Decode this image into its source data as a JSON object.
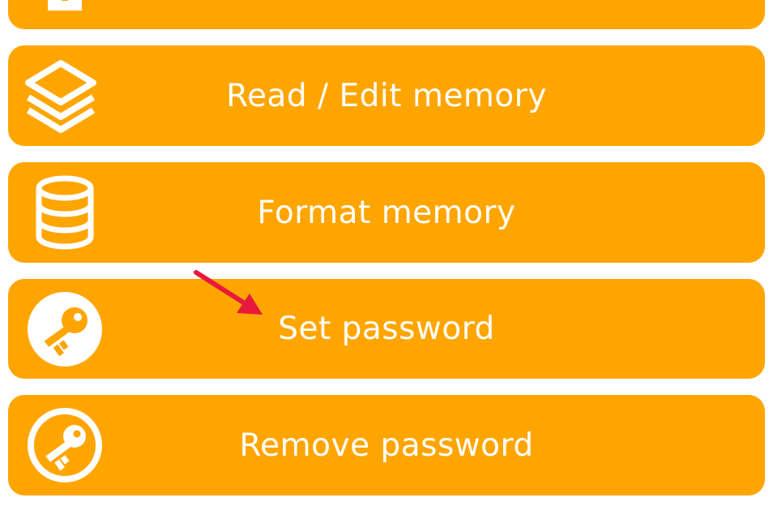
{
  "accent_color": "#FFA500",
  "text_color": "#FFFFFF",
  "annotation_arrow_color": "#E8193C",
  "menu": {
    "items": [
      {
        "label": "",
        "icon": "square-icon"
      },
      {
        "label": "Read / Edit memory",
        "icon": "layers-icon"
      },
      {
        "label": "Format memory",
        "icon": "database-icon"
      },
      {
        "label": "Set password",
        "icon": "key-circle-filled-icon"
      },
      {
        "label": "Remove password",
        "icon": "key-circle-outline-icon"
      }
    ]
  }
}
